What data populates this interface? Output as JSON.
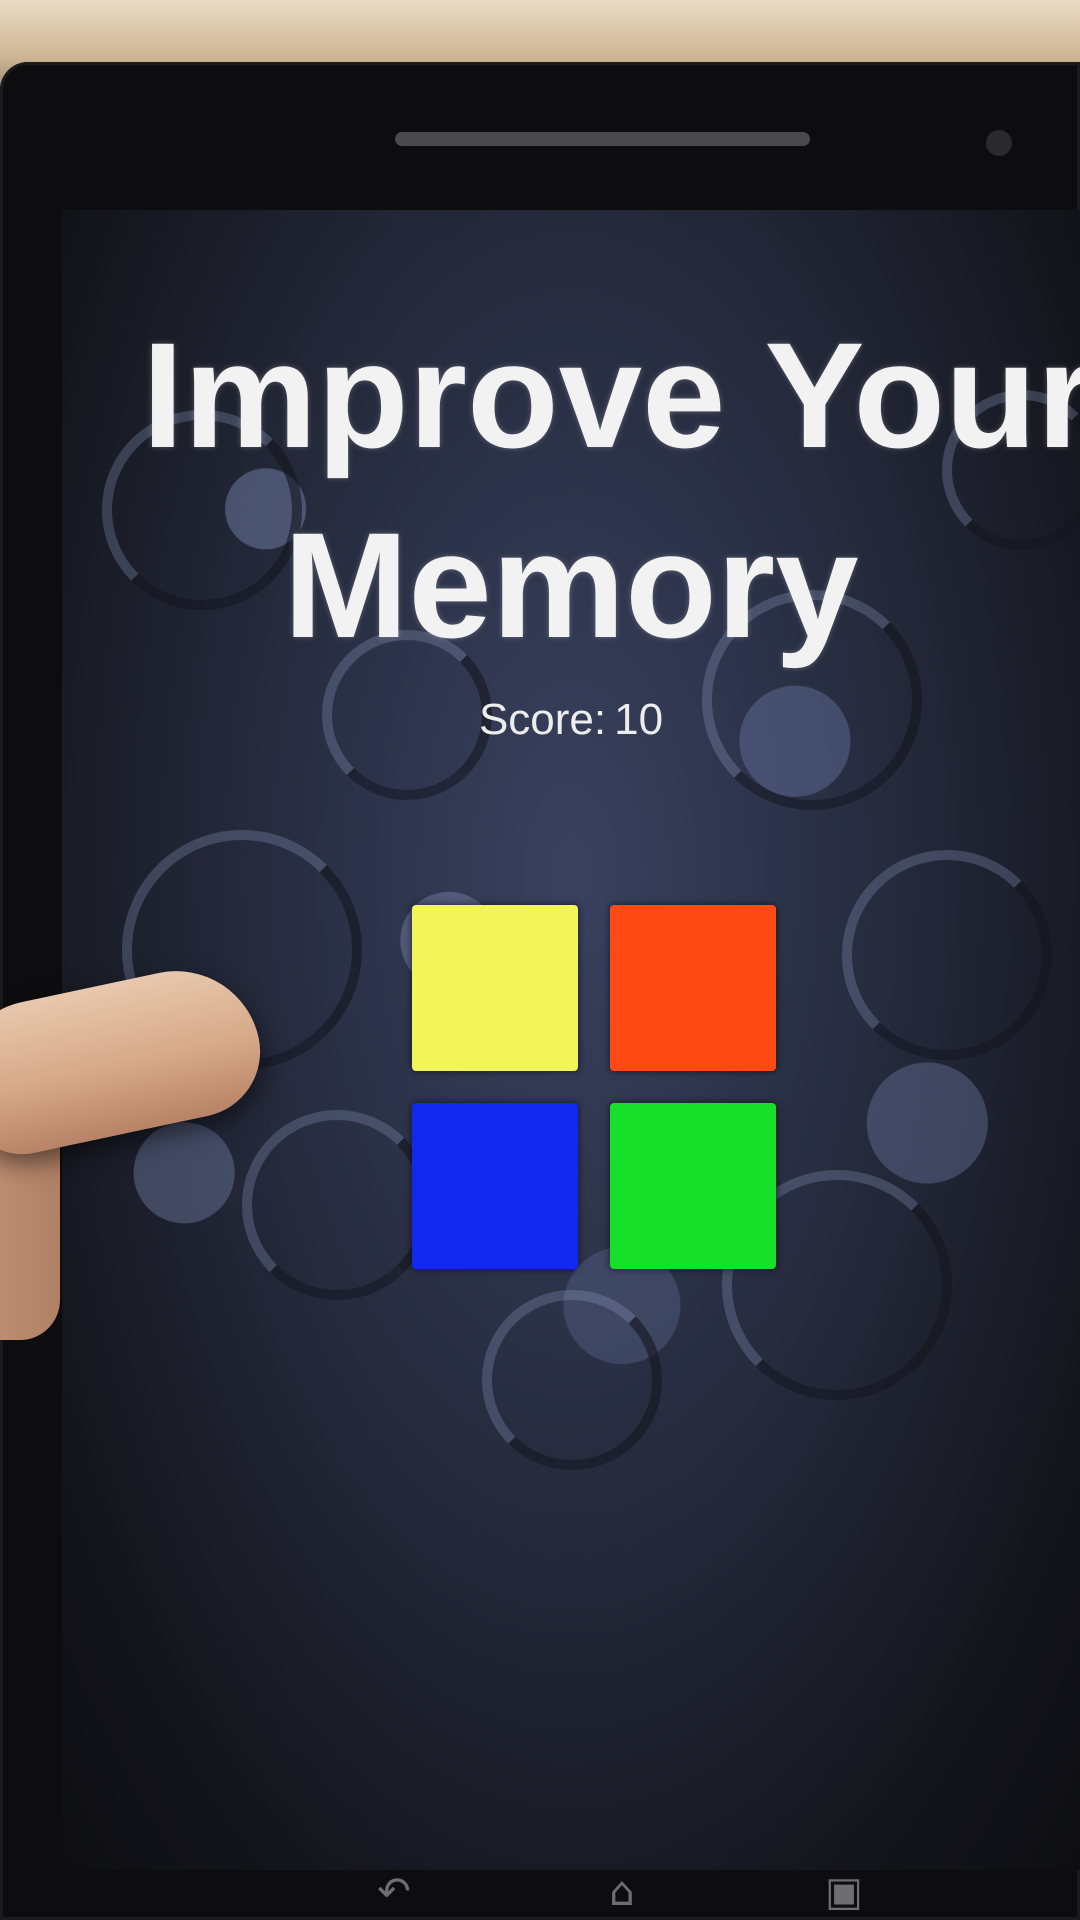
{
  "game": {
    "title_line1": "Improve Your",
    "title_line2": "Memory",
    "score_label": "Score:",
    "score_value": "10"
  },
  "tiles": [
    {
      "color_name": "yellow",
      "color": "#f3f35a"
    },
    {
      "color_name": "red",
      "color": "#ff4a14"
    },
    {
      "color_name": "blue",
      "color": "#1028f0"
    },
    {
      "color_name": "green",
      "color": "#17e02a"
    }
  ],
  "navigation": {
    "back_icon": "back-icon",
    "home_icon": "home-icon",
    "recent_icon": "recent-apps-icon"
  }
}
